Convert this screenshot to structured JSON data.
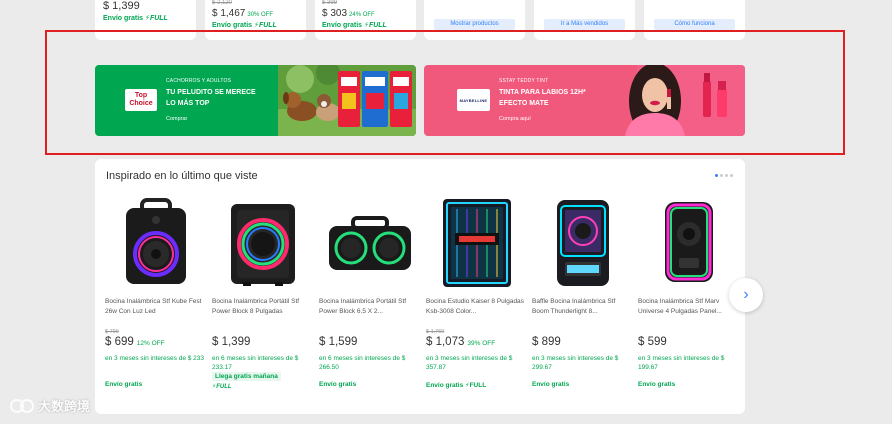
{
  "top_cards": [
    {
      "price": "$ 1,399",
      "shipping": "Envío gratis",
      "full": "⚡FULL"
    },
    {
      "old_price": "$ 2,120",
      "price": "$ 1,467",
      "off": "30% OFF",
      "shipping": "Envío gratis",
      "full": "⚡FULL"
    },
    {
      "old_price": "$ 399",
      "price": "$ 303",
      "off": "24% OFF",
      "shipping": "Envío gratis",
      "full": "⚡FULL"
    },
    {
      "button": "Mostrar productos"
    },
    {
      "button": "Ir a Más vendidos"
    },
    {
      "button": "Cómo funciona"
    }
  ],
  "banners": {
    "top_choice": {
      "logo": "Top Choice",
      "kicker": "CACHORROS Y ADULTOS",
      "title": "TU PELUDITO SE MERECE LO MÁS TOP",
      "link": "Comprar",
      "color": "#00a650"
    },
    "maybelline": {
      "logo": "MAYBELLINE",
      "kicker": "SSTAY TEDDY TINT",
      "title": "TINTA PARA LABIOS 12H* EFECTO MATE",
      "link": "Compra aquí",
      "color": "#f0597c"
    }
  },
  "section": {
    "title": "Inspirado en lo último que viste",
    "products": [
      {
        "title": "Bocina Inalámbrica Stf Kube Fest 26w Con Luz Led",
        "old_price": "$ 799",
        "price": "$ 699",
        "off": "12% OFF",
        "installments": "en 3 meses sin intereses de $ 233",
        "shipping": "Envío gratis"
      },
      {
        "title": "Bocina Inalámbrica Portátil Stf Power Block 8 Pulgadas",
        "price": "$ 1,399",
        "installments": "en 6 meses sin intereses de $ 233.17",
        "badge": "Llega gratis mañana",
        "full": "⚡FULL"
      },
      {
        "title": "Bocina Inalámbrica Portátil Stf Power Block 6.5 X 2...",
        "price": "$ 1,599",
        "installments": "en 6 meses sin intereses de $ 266.50",
        "shipping": "Envío gratis"
      },
      {
        "title": "Bocina Estudio Kaiser 8 Pulgadas Ksb-3008 Color...",
        "old_price": "$ 1,760",
        "price": "$ 1,073",
        "off": "39% OFF",
        "installments": "en 3 meses sin intereses de $ 357.87",
        "shipping": "Envío gratis ⚡FULL"
      },
      {
        "title": "Baffle Bocina Inalámbrica Stf Boom Thunderlight 8...",
        "price": "$ 899",
        "installments": "en 3 meses sin intereses de $ 299.67",
        "shipping": "Envío gratis"
      },
      {
        "title": "Bocina Inalámbrica Stf Marv Universe 4 Pulgadas Panel...",
        "price": "$ 599",
        "installments": "en 3 meses sin intereses de $ 199.67",
        "shipping": "Envío gratis"
      }
    ]
  },
  "watermark": "大数跨境",
  "colors": {
    "accent": "#3483fa",
    "green": "#00a650",
    "highlight": "#e02020"
  }
}
